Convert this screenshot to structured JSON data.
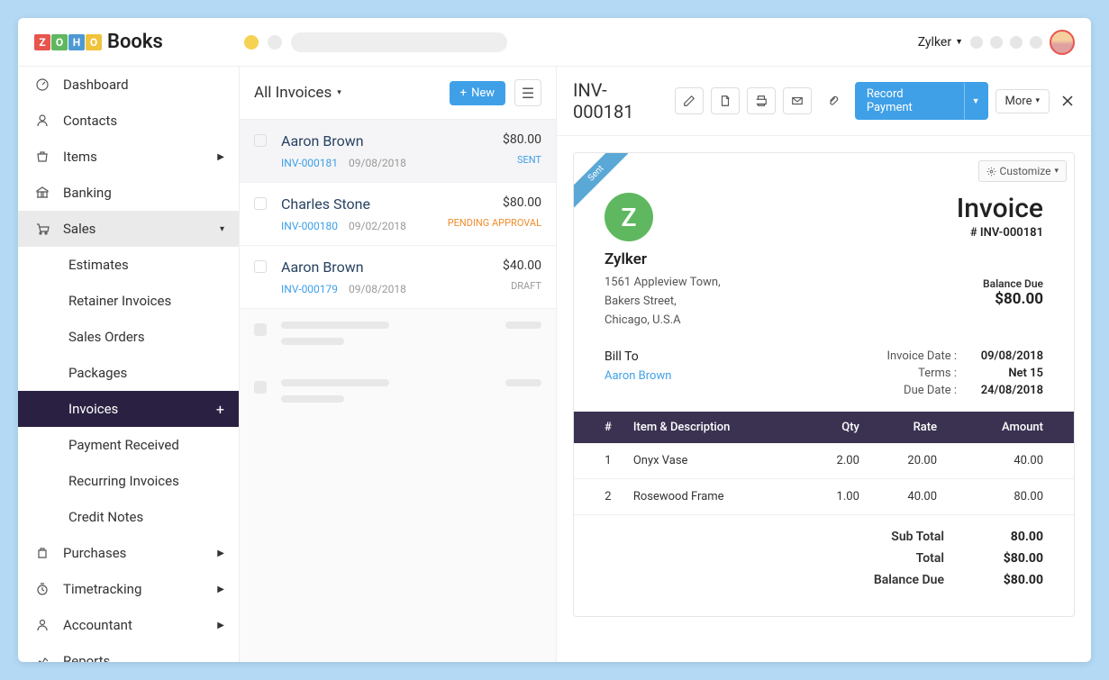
{
  "brand": {
    "books": "Books",
    "zoho_letters": [
      "Z",
      "O",
      "H",
      "O"
    ]
  },
  "topbar": {
    "company": "Zylker"
  },
  "sidebar": {
    "dashboard": "Dashboard",
    "contacts": "Contacts",
    "items": "Items",
    "banking": "Banking",
    "sales": "Sales",
    "estimates": "Estimates",
    "retainer_invoices": "Retainer Invoices",
    "sales_orders": "Sales Orders",
    "packages": "Packages",
    "invoices": "Invoices",
    "payment_received": "Payment Received",
    "recurring_invoices": "Recurring Invoices",
    "credit_notes": "Credit Notes",
    "purchases": "Purchases",
    "timetracking": "Timetracking",
    "accountant": "Accountant",
    "reports": "Reports"
  },
  "list": {
    "title": "All Invoices",
    "new_label": "New",
    "items": [
      {
        "name": "Aaron Brown",
        "inv": "INV-000181",
        "date": "09/08/2018",
        "amount": "$80.00",
        "status": "SENT",
        "status_cls": "status-sent"
      },
      {
        "name": "Charles Stone",
        "inv": "INV-000180",
        "date": "09/02/2018",
        "amount": "$80.00",
        "status": "PENDING APPROVAL",
        "status_cls": "status-pending"
      },
      {
        "name": "Aaron Brown",
        "inv": "INV-000179",
        "date": "09/08/2018",
        "amount": "$40.00",
        "status": "DRAFT",
        "status_cls": "status-draft"
      }
    ]
  },
  "detail": {
    "title": "INV-000181",
    "record_payment": "Record Payment",
    "more": "More",
    "customize": "Customize",
    "ribbon": "Sent",
    "company": {
      "logo_letter": "Z",
      "name": "Zylker",
      "addr1": "1561 Appleview Town,",
      "addr2": "Bakers Street,",
      "addr3": "Chicago, U.S.A"
    },
    "invoice_title": "Invoice",
    "invoice_number": "# INV-000181",
    "balance_due_label": "Balance Due",
    "balance_due_value": "$80.00",
    "bill_to_label": "Bill To",
    "bill_to_name": "Aaron Brown",
    "meta": {
      "invoice_date_label": "Invoice Date :",
      "invoice_date": "09/08/2018",
      "terms_label": "Terms :",
      "terms": "Net 15",
      "due_date_label": "Due Date :",
      "due_date": "24/08/2018"
    },
    "table": {
      "col_num": "#",
      "col_item": "Item & Description",
      "col_qty": "Qty",
      "col_rate": "Rate",
      "col_amount": "Amount",
      "rows": [
        {
          "n": "1",
          "item": "Onyx Vase",
          "qty": "2.00",
          "rate": "20.00",
          "amount": "40.00"
        },
        {
          "n": "2",
          "item": "Rosewood Frame",
          "qty": "1.00",
          "rate": "40.00",
          "amount": "80.00"
        }
      ]
    },
    "totals": {
      "subtotal_label": "Sub Total",
      "subtotal": "80.00",
      "total_label": "Total",
      "total": "$80.00",
      "balance_label": "Balance Due",
      "balance": "$80.00"
    }
  }
}
